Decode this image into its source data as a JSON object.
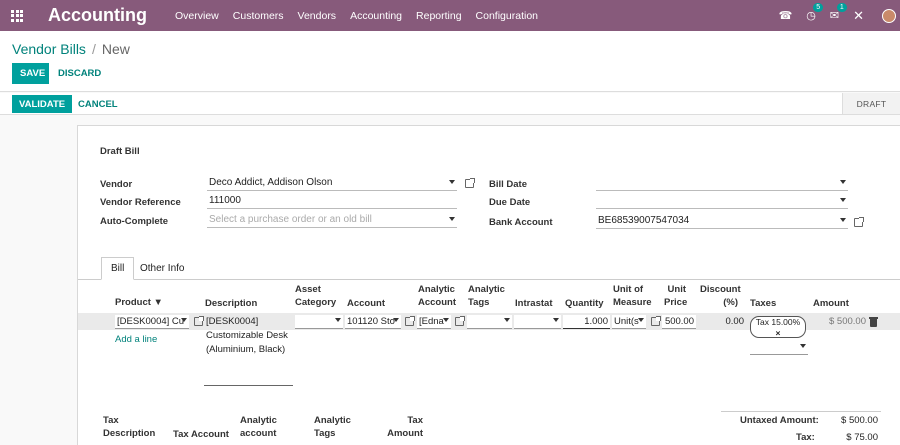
{
  "topbar": {
    "brand": "Accounting",
    "menu": [
      "Overview",
      "Customers",
      "Vendors",
      "Accounting",
      "Reporting",
      "Configuration"
    ],
    "activity_count": "5",
    "message_count": "1"
  },
  "breadcrumb": {
    "parent": "Vendor Bills",
    "current": "New"
  },
  "buttons": {
    "save": "SAVE",
    "discard": "DISCARD",
    "validate": "VALIDATE",
    "cancel": "CANCEL"
  },
  "status": {
    "stage": "DRAFT"
  },
  "form": {
    "title": "Draft Bill",
    "vendor_label": "Vendor",
    "vendor_value": "Deco Addict, Addison Olson",
    "vendor_ref_label": "Vendor Reference",
    "vendor_ref_value": "111000",
    "autocomplete_label": "Auto-Complete",
    "autocomplete_placeholder": "Select a purchase order or an old bill",
    "bill_date_label": "Bill Date",
    "due_date_label": "Due Date",
    "bank_label": "Bank Account",
    "bank_value": "BE68539007547034"
  },
  "tabs": [
    "Bill",
    "Other Info"
  ],
  "lines": {
    "headers": {
      "product": "Product",
      "description": "Description",
      "asset_category_1": "Asset",
      "asset_category_2": "Category",
      "account": "Account",
      "analytic_account_1": "Analytic",
      "analytic_account_2": "Account",
      "analytic_tags_1": "Analytic",
      "analytic_tags_2": "Tags",
      "intrastat": "Intrastat",
      "quantity": "Quantity",
      "uom_1": "Unit of",
      "uom_2": "Measure",
      "price_1": "Unit",
      "price_2": "Price",
      "discount_1": "Discount",
      "discount_2": "(%)",
      "taxes": "Taxes",
      "amount": "Amount"
    },
    "row": {
      "product": "[DESK0004] Cu",
      "description_1": "[DESK0004]",
      "description_2": "Customizable Desk",
      "description_3": "(Aluminium, Black)",
      "account": "101120 Sto",
      "analytic_account": "[Edna",
      "quantity": "1.000",
      "uom": "Unit(s",
      "price": "500.00",
      "discount": "0.00",
      "tax": "Tax 15.00%",
      "amount": "$ 500.00"
    },
    "add_line": "Add a line"
  },
  "tax_table": {
    "h_desc_1": "Tax",
    "h_desc_2": "Description",
    "h_account": "Tax Account",
    "h_analytic_account_1": "Analytic",
    "h_analytic_account_2": "account",
    "h_analytic_tags_1": "Analytic",
    "h_analytic_tags_2": "Tags",
    "h_amount_1": "Tax",
    "h_amount_2": "Amount"
  },
  "totals": {
    "untaxed_label": "Untaxed Amount:",
    "untaxed_value": "$ 500.00",
    "tax_label": "Tax:",
    "tax_value": "$ 75.00"
  },
  "colors": {
    "brand": "#875a7b",
    "primary": "#00a09d",
    "link": "#00827b"
  }
}
